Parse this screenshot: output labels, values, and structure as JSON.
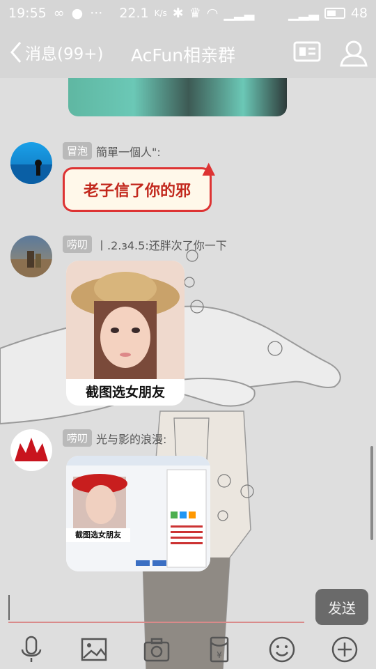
{
  "status_bar": {
    "time": "19:55",
    "speed": "22.1",
    "speed_unit": "K/s",
    "battery": "48"
  },
  "header": {
    "back_label": "消息(99+)",
    "title": "AcFun相亲群"
  },
  "messages": [
    {
      "tag": "冒泡",
      "sender": "簡單一個人\":",
      "sticker_text": "老子信了你的邪"
    },
    {
      "tag": "唠叨",
      "sender": "丨.2.з4.5:还胖次了你一下",
      "image_caption": "截图选女朋友"
    },
    {
      "tag": "唠叨",
      "sender": "光与影的浪漫:",
      "image_caption": "截图选女朋友"
    }
  ],
  "composer": {
    "send_label": "发送"
  },
  "toolbar": {
    "icons": [
      "microphone-icon",
      "image-icon",
      "camera-icon",
      "red-packet-icon",
      "emoji-icon",
      "plus-icon"
    ]
  },
  "colors": {
    "header_text": "#ffffff",
    "tag_bg": "#b9b9b9",
    "sticker_text": "#c2281d",
    "send_bg": "#6a6a6a"
  }
}
